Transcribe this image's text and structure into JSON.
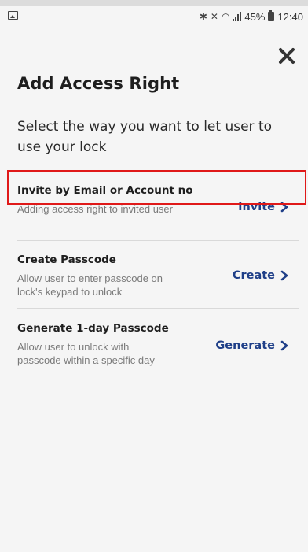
{
  "status_bar": {
    "time": "12:40",
    "battery": "45%",
    "icons": [
      "picture-icon",
      "bluetooth-icon",
      "mute-icon",
      "wifi-icon",
      "signal-icon",
      "battery-icon"
    ]
  },
  "header": {
    "title": "Add Access Right",
    "close_icon": "close-icon"
  },
  "subtitle": "Select the way you want to let user to use your lock",
  "options": [
    {
      "title": "Invite by Email or Account no",
      "description": "Adding access right to invited user",
      "action": "Invite"
    },
    {
      "title": "Create Passcode",
      "description": "Allow user to enter passcode on lock's keypad to unlock",
      "action": "Create"
    },
    {
      "title": "Generate 1-day Passcode",
      "description": "Allow user to unlock with passcode within a specific day",
      "action": "Generate"
    }
  ],
  "colors": {
    "action": "#1f3f88",
    "highlight": "#e01919",
    "background": "#f5f5f5"
  }
}
